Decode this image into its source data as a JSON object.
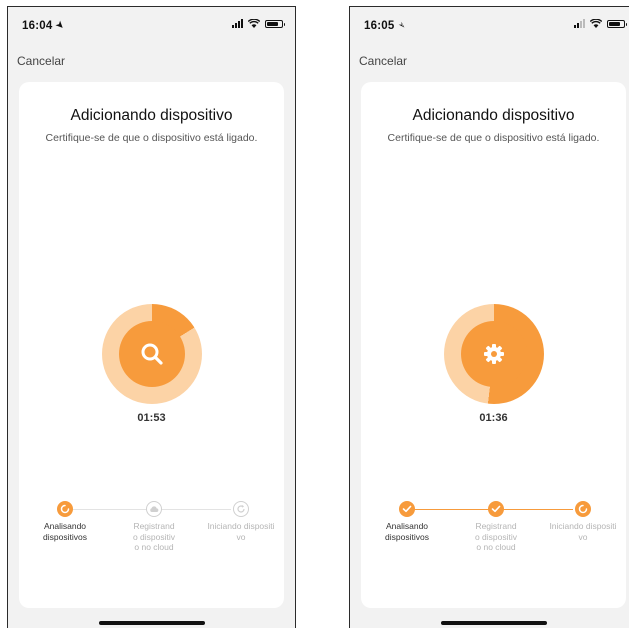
{
  "colors": {
    "accent": "#f79b3c",
    "accent_light": "#fcd3a6",
    "inactive": "#d0d0d0"
  },
  "screens": [
    {
      "time": "16:04",
      "cancel_label": "Cancelar",
      "title": "Adicionando dispositivo",
      "subtitle": "Certifique-se de que o dispositivo está ligado.",
      "center_icon": "search-icon",
      "timer": "01:53",
      "progress": 0.16,
      "steps": [
        {
          "label": "Analisando dispositivos",
          "state": "active"
        },
        {
          "label": "Registrando dispositivo no cloud",
          "state": "pending"
        },
        {
          "label": "Iniciando dispositivo",
          "state": "pending"
        }
      ]
    },
    {
      "time": "16:05",
      "cancel_label": "Cancelar",
      "title": "Adicionando dispositivo",
      "subtitle": "Certifique-se de que o dispositivo está ligado.",
      "center_icon": "gear-icon",
      "timer": "01:36",
      "progress": 0.52,
      "steps": [
        {
          "label": "Analisando dispositivos",
          "state": "done"
        },
        {
          "label": "Registrando dispositivo no cloud",
          "state": "done"
        },
        {
          "label": "Iniciando dispositivo",
          "state": "active"
        }
      ]
    }
  ]
}
